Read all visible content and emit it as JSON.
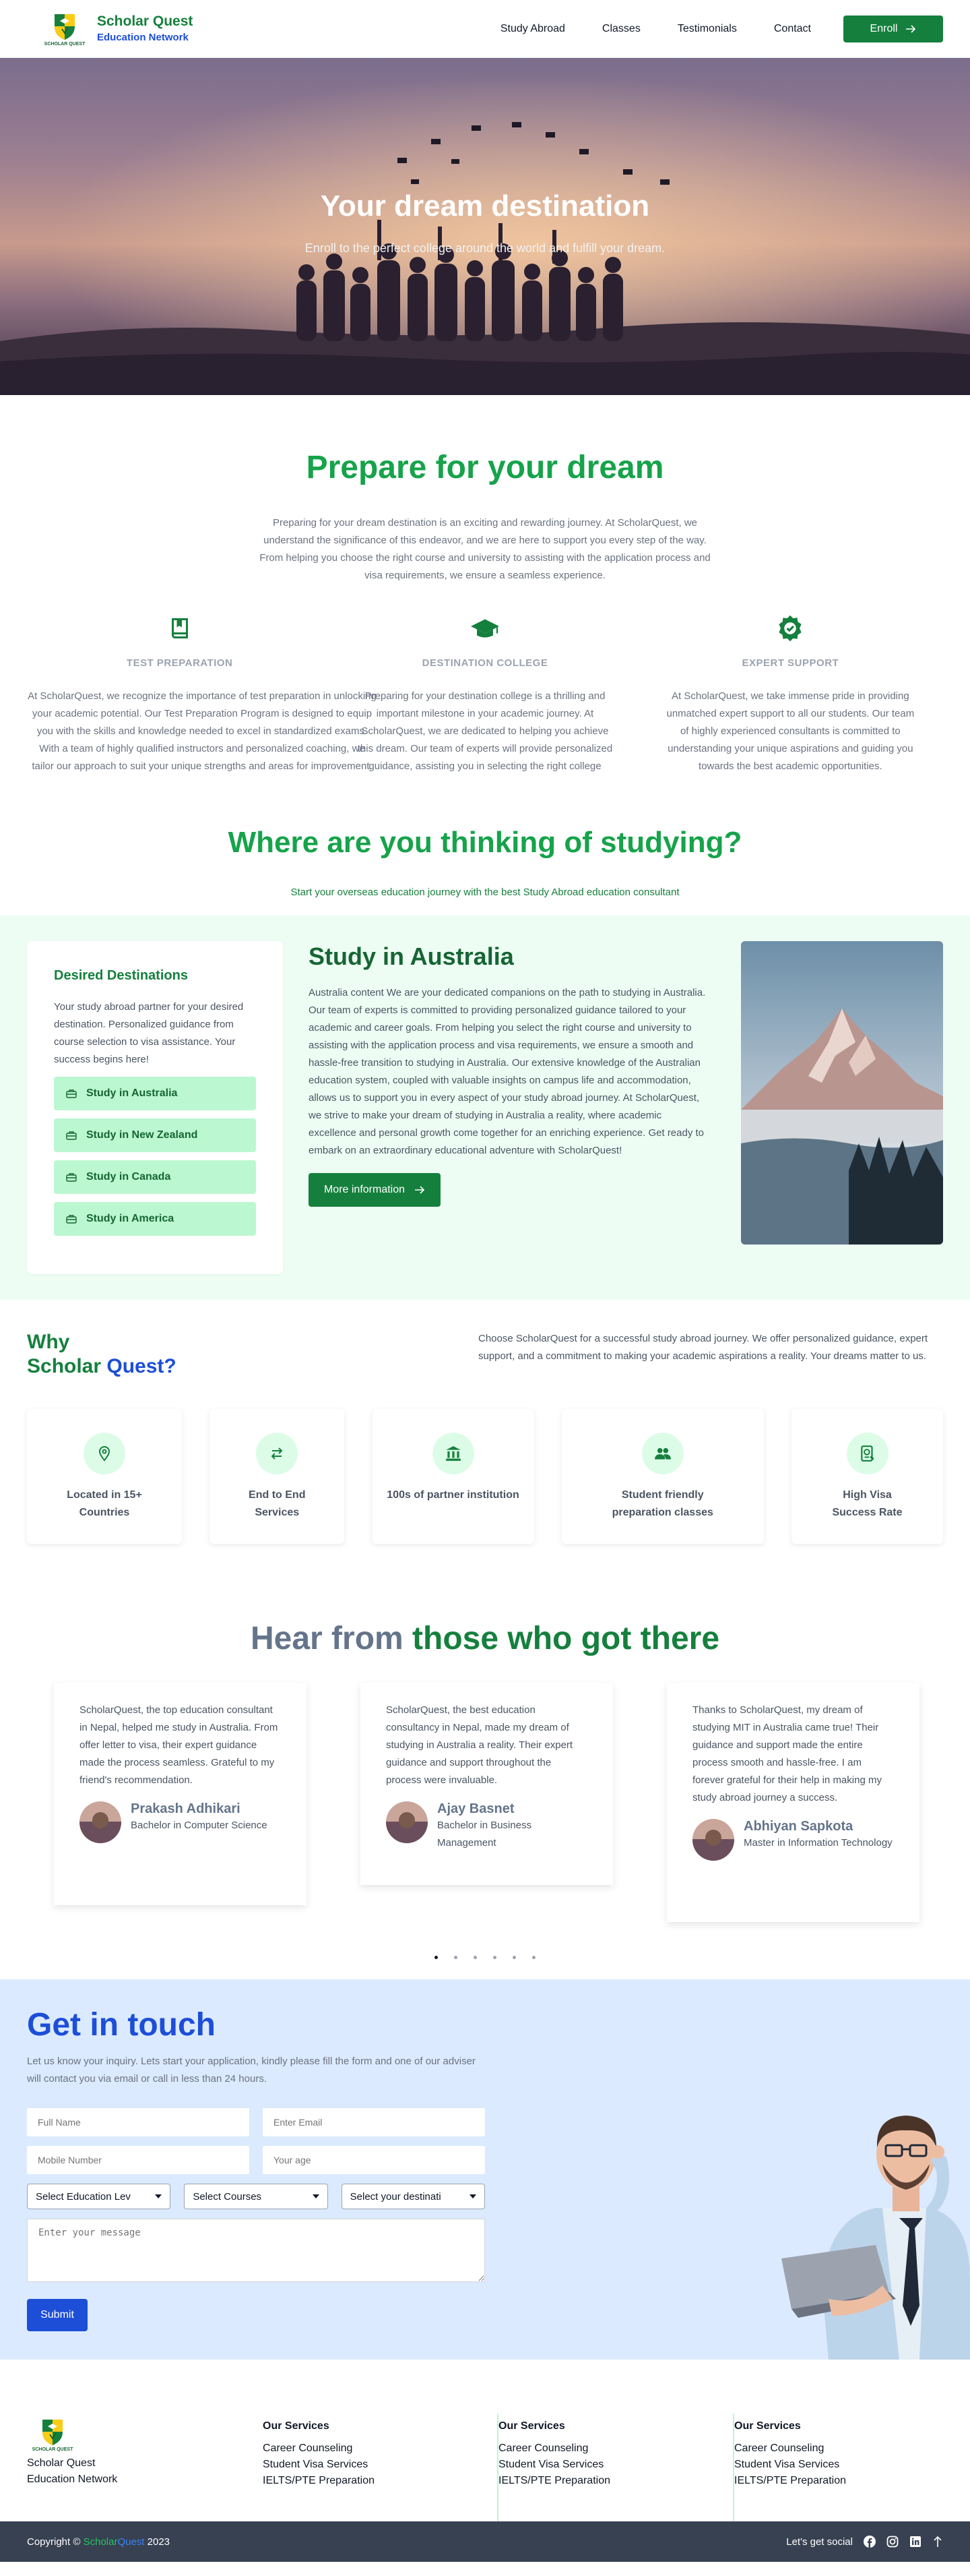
{
  "header": {
    "logo_text": "SCHOLAR QUEST",
    "brand_name": "Scholar Quest",
    "brand_sub": "Education Network",
    "nav": [
      "Study Abroad",
      "Classes",
      "Testimonials",
      "Contact"
    ],
    "enroll_label": "Enroll"
  },
  "hero": {
    "title": "Your dream destination",
    "subtitle": "Enroll to the perfect college around the world and fulfill your dream."
  },
  "prepare": {
    "title": "Prepare for your dream",
    "intro": "Preparing for your dream destination is an exciting and rewarding journey. At ScholarQuest, we understand the significance of this endeavor, and we are here to support you every step of the way. From helping you choose the right course and university to assisting with the application process and visa requirements, we ensure a seamless experience.",
    "features": [
      {
        "title": "TEST PREPARATION",
        "icon": "book-icon",
        "text": "At ScholarQuest, we recognize the importance of test preparation in unlocking your academic potential. Our Test Preparation Program is designed to equip you with the skills and knowledge needed to excel in standardized exams. With a team of highly qualified instructors and personalized coaching, we tailor our approach to suit your unique strengths and areas for improvement."
      },
      {
        "title": "DESTINATION COLLEGE",
        "icon": "graduation-cap-icon",
        "text": "Preparing for your destination college is a thrilling and important milestone in your academic journey. At ScholarQuest, we are dedicated to helping you achieve this dream. Our team of experts will provide personalized guidance, assisting you in selecting the right college"
      },
      {
        "title": "EXPERT SUPPORT",
        "icon": "badge-check-icon",
        "text": "At ScholarQuest, we take immense pride in providing unmatched expert support to all our students. Our team of highly experienced consultants is committed to understanding your unique aspirations and guiding you towards the best academic opportunities."
      }
    ]
  },
  "where": {
    "title": "Where are you thinking of studying?",
    "subtitle": "Start your overseas education journey with the best Study Abroad education consultant"
  },
  "study": {
    "card_title": "Desired Destinations",
    "card_text": "Your study abroad partner for your desired destination. Personalized guidance from course selection to visa assistance. Your success begins here!",
    "destinations": [
      "Study in Australia",
      "Study in New Zealand",
      "Study in Canada",
      "Study in America"
    ],
    "title": "Study in Australia",
    "text": "Australia content We are your dedicated companions on the path to studying in Australia. Our team of experts is committed to providing personalized guidance tailored to your academic and career goals. From helping you select the right course and university to assisting with the application process and visa requirements, we ensure a smooth and hassle-free transition to studying in Australia. Our extensive knowledge of the Australian education system, coupled with valuable insights on campus life and accommodation, allows us to support you in every aspect of your study abroad journey. At ScholarQuest, we strive to make your dream of studying in Australia a reality, where academic excellence and personal growth come together for an enriching experience. Get ready to embark on an extraordinary educational adventure with ScholarQuest!",
    "button": "More information"
  },
  "why": {
    "title_line1": "Why",
    "title_scholar": "Scholar",
    "title_quest": "Quest?",
    "desc": "Choose ScholarQuest for a successful study abroad journey. We offer personalized guidance, expert support, and a commitment to making your academic aspirations a reality. Your dreams matter to us.",
    "cards": [
      {
        "label": "Located in 15+ Countries",
        "icon": "map-pin-icon"
      },
      {
        "label": "End to End Services",
        "icon": "arrows-exchange-icon"
      },
      {
        "label": "100s of partner institution",
        "icon": "bank-icon"
      },
      {
        "label": "Student friendly preparation classes",
        "icon": "users-icon"
      },
      {
        "label": "High Visa Success Rate",
        "icon": "passport-icon"
      }
    ]
  },
  "testimonials": {
    "title_a": "Hear from",
    "title_b": "those who got there",
    "items": [
      {
        "quote": "ScholarQuest, the top education consultant in Nepal, helped me study in Australia. From offer letter to visa, their expert guidance made the process seamless. Grateful to my friend's recommendation.",
        "name": "Prakash Adhikari",
        "role": "Bachelor in Computer Science"
      },
      {
        "quote": "ScholarQuest, the best education consultancy in Nepal, made my dream of studying in Australia a reality. Their expert guidance and support throughout the process were invaluable.",
        "name": "Ajay Basnet",
        "role": "Bachelor in Business Management"
      },
      {
        "quote": "Thanks to ScholarQuest, my dream of studying MIT in Australia came true! Their guidance and support made the entire process smooth and hassle-free. I am forever grateful for their help in making my study abroad journey a success.",
        "name": "Abhiyan Sapkota",
        "role": "Master in Information Technology"
      }
    ]
  },
  "contact": {
    "title": "Get in touch",
    "desc": "Let us know your inquiry. Lets start your application, kindly please fill the form and one of our adviser will contact you via email or call in less than 24 hours.",
    "ph_name": "Full Name",
    "ph_email": "Enter Email",
    "ph_mobile": "Mobile Number",
    "ph_age": "Your age",
    "sel_level": "Select Education Lev",
    "sel_course": "Select Courses",
    "sel_dest": "Select your destinati",
    "ph_message": "Enter your message",
    "submit": "Submit"
  },
  "footer": {
    "brand_line1": "Scholar Quest",
    "brand_line2": "Education Network",
    "columns": [
      {
        "title": "Our Services",
        "items": [
          "Career Counseling",
          "Student Visa Services",
          "IELTS/PTE Preparation"
        ]
      },
      {
        "title": "Our Services",
        "items": [
          "Career Counseling",
          "Student Visa Services",
          "IELTS/PTE Preparation"
        ]
      },
      {
        "title": "Our Services",
        "items": [
          "Career Counseling",
          "Student Visa Services",
          "IELTS/PTE Preparation"
        ]
      }
    ],
    "copyright_prefix": "Copyright ©",
    "copyright_scholar": "Scholar",
    "copyright_quest": "Quest",
    "copyright_year": "2023",
    "social_label": "Let's get social"
  },
  "colors": {
    "green": "#15803d",
    "blue": "#1d4ed8",
    "light_green": "#edfdf3",
    "light_blue": "#dbeafe",
    "dark": "#374151"
  }
}
